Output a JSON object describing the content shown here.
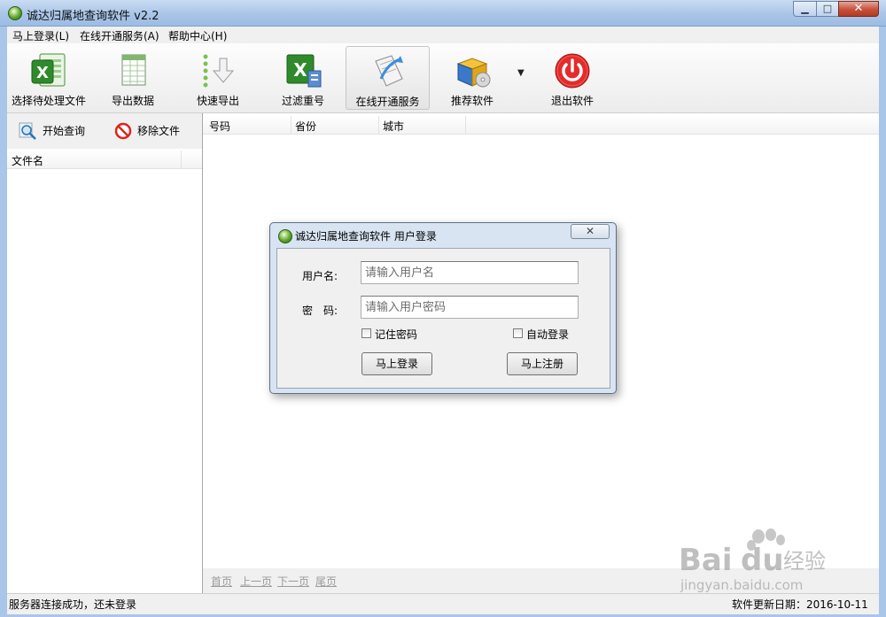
{
  "window": {
    "title": "诚达归属地查询软件 v2.2"
  },
  "menu": {
    "items": [
      "马上登录(L)",
      "在线开通服务(A)",
      "帮助中心(H)"
    ]
  },
  "toolbar": {
    "buttons": [
      {
        "label": "选择待处理文件",
        "icon": "excel-open-icon"
      },
      {
        "label": "导出数据",
        "icon": "spreadsheet-export-icon"
      },
      {
        "label": "快速导出",
        "icon": "quick-export-arrow-icon"
      },
      {
        "label": "过滤重号",
        "icon": "excel-filter-icon"
      },
      {
        "label": "在线开通服务",
        "icon": "online-service-icon"
      },
      {
        "label": "推荐软件",
        "icon": "software-box-icon"
      },
      {
        "label": "退出软件",
        "icon": "power-icon"
      }
    ]
  },
  "left_panel": {
    "start_query": "开始查询",
    "remove_file": "移除文件",
    "file_header": "文件名"
  },
  "grid": {
    "columns": [
      "号码",
      "省份",
      "城市"
    ]
  },
  "pager": {
    "first": "首页",
    "prev": "上一页",
    "next": "下一页",
    "last": "尾页"
  },
  "status": {
    "left": "服务器连接成功，还未登录",
    "right": "软件更新日期：2016-10-11"
  },
  "dialog": {
    "title": "诚达归属地查询软件 用户登录",
    "username_label": "用户名:",
    "username_placeholder": "请输入用户名",
    "password_label": "密　码:",
    "password_placeholder": "请输入用户密码",
    "remember_password": "记住密码",
    "auto_login": "自动登录",
    "login_button": "马上登录",
    "register_button": "马上注册"
  },
  "watermark": {
    "brand": "Bai",
    "brand2": "du",
    "cn": "经验",
    "url": "jingyan.baidu.com"
  },
  "colors": {
    "title_bar": "#a9c5e8",
    "close_button": "#c7503a",
    "dialog_frame": "#d8e4f2"
  }
}
